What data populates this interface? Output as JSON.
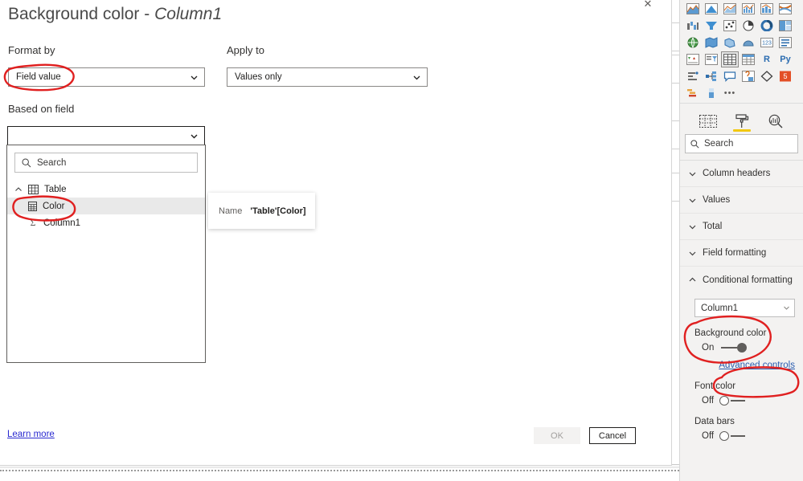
{
  "dialog": {
    "title_main": "Background color - ",
    "title_em": "Column1",
    "close_icon": "close-icon",
    "format_by": {
      "label": "Format by",
      "value": "Field value"
    },
    "apply_to": {
      "label": "Apply to",
      "value": "Values only"
    },
    "based_on_field": {
      "label": "Based on field",
      "value": ""
    },
    "field_dropdown": {
      "search_placeholder": "Search",
      "search_icon": "search-icon",
      "tree": [
        {
          "label": "Table",
          "icon": "table-icon",
          "type": "table",
          "expanded": true
        },
        {
          "label": "Color",
          "icon": "column-icon",
          "type": "column",
          "selected": true
        },
        {
          "label": "Column1",
          "icon": "sigma-icon",
          "type": "measure",
          "selected": false
        }
      ]
    },
    "tooltip": {
      "key": "Name",
      "value": "'Table'[Color]"
    },
    "footer": {
      "learn_more": "Learn more",
      "ok": "OK",
      "cancel": "Cancel"
    }
  },
  "right_rail": {
    "viz_rows": [
      [
        {
          "icon": "area-chart-icon"
        },
        {
          "icon": "filled-area-chart-icon"
        },
        {
          "icon": "line-area-chart-icon"
        },
        {
          "icon": "line-clustered-column-icon"
        },
        {
          "icon": "line-stacked-column-icon"
        },
        {
          "icon": "ribbon-chart-icon"
        }
      ],
      [
        {
          "icon": "waterfall-chart-icon"
        },
        {
          "icon": "funnel-chart-icon"
        },
        {
          "icon": "scatter-chart-icon"
        },
        {
          "icon": "pie-chart-icon"
        },
        {
          "icon": "donut-chart-icon"
        },
        {
          "icon": "treemap-icon"
        }
      ],
      [
        {
          "icon": "map-icon"
        },
        {
          "icon": "filled-map-icon"
        },
        {
          "icon": "shape-map-icon"
        },
        {
          "icon": "azure-map-icon"
        },
        {
          "icon": "card-icon"
        },
        {
          "icon": "multi-row-card-icon"
        }
      ],
      [
        {
          "icon": "kpi-icon"
        },
        {
          "icon": "slicer-icon"
        },
        {
          "icon": "table-icon",
          "selected": true
        },
        {
          "icon": "matrix-icon"
        },
        {
          "icon": "r-visual-icon",
          "letter": "R"
        },
        {
          "icon": "python-visual-icon",
          "letter": "Py"
        }
      ],
      [
        {
          "icon": "key-influencers-icon"
        },
        {
          "icon": "decomposition-tree-icon"
        },
        {
          "icon": "qa-visual-icon"
        },
        {
          "icon": "smart-narrative-icon"
        },
        {
          "icon": "paginated-report-icon"
        },
        {
          "icon": "html-viewer-icon"
        }
      ],
      [
        {
          "icon": "gantt-icon"
        },
        {
          "icon": "bullet-chart-icon"
        },
        {
          "icon": "more-options-icon",
          "dots": true
        }
      ]
    ],
    "pane_tabs": [
      {
        "name": "fields-pane-tab",
        "icon": "fields-icon",
        "active": false
      },
      {
        "name": "format-pane-tab",
        "icon": "paint-roller-icon",
        "active": true
      },
      {
        "name": "analytics-pane-tab",
        "icon": "magnifier-icon",
        "active": false
      }
    ],
    "search": {
      "placeholder": "Search",
      "icon": "search-icon"
    },
    "sections": [
      {
        "label": "Column headers",
        "expanded": false
      },
      {
        "label": "Values",
        "expanded": false
      },
      {
        "label": "Total",
        "expanded": false
      },
      {
        "label": "Field formatting",
        "expanded": false
      },
      {
        "label": "Conditional formatting",
        "expanded": true
      }
    ],
    "conditional_formatting": {
      "selected_column": "Column1",
      "controls": [
        {
          "label": "Background color",
          "state": "On",
          "on": true
        },
        {
          "label": "Font color",
          "state": "Off",
          "on": false
        },
        {
          "label": "Data bars",
          "state": "Off",
          "on": false
        }
      ],
      "advanced_controls": "Advanced controls"
    }
  },
  "annotations": {
    "color": "#e02020",
    "marks": [
      {
        "name": "annotation-format-by-circle"
      },
      {
        "name": "annotation-color-field-circle"
      },
      {
        "name": "annotation-background-color-circle"
      },
      {
        "name": "annotation-advanced-controls-circle"
      }
    ]
  }
}
